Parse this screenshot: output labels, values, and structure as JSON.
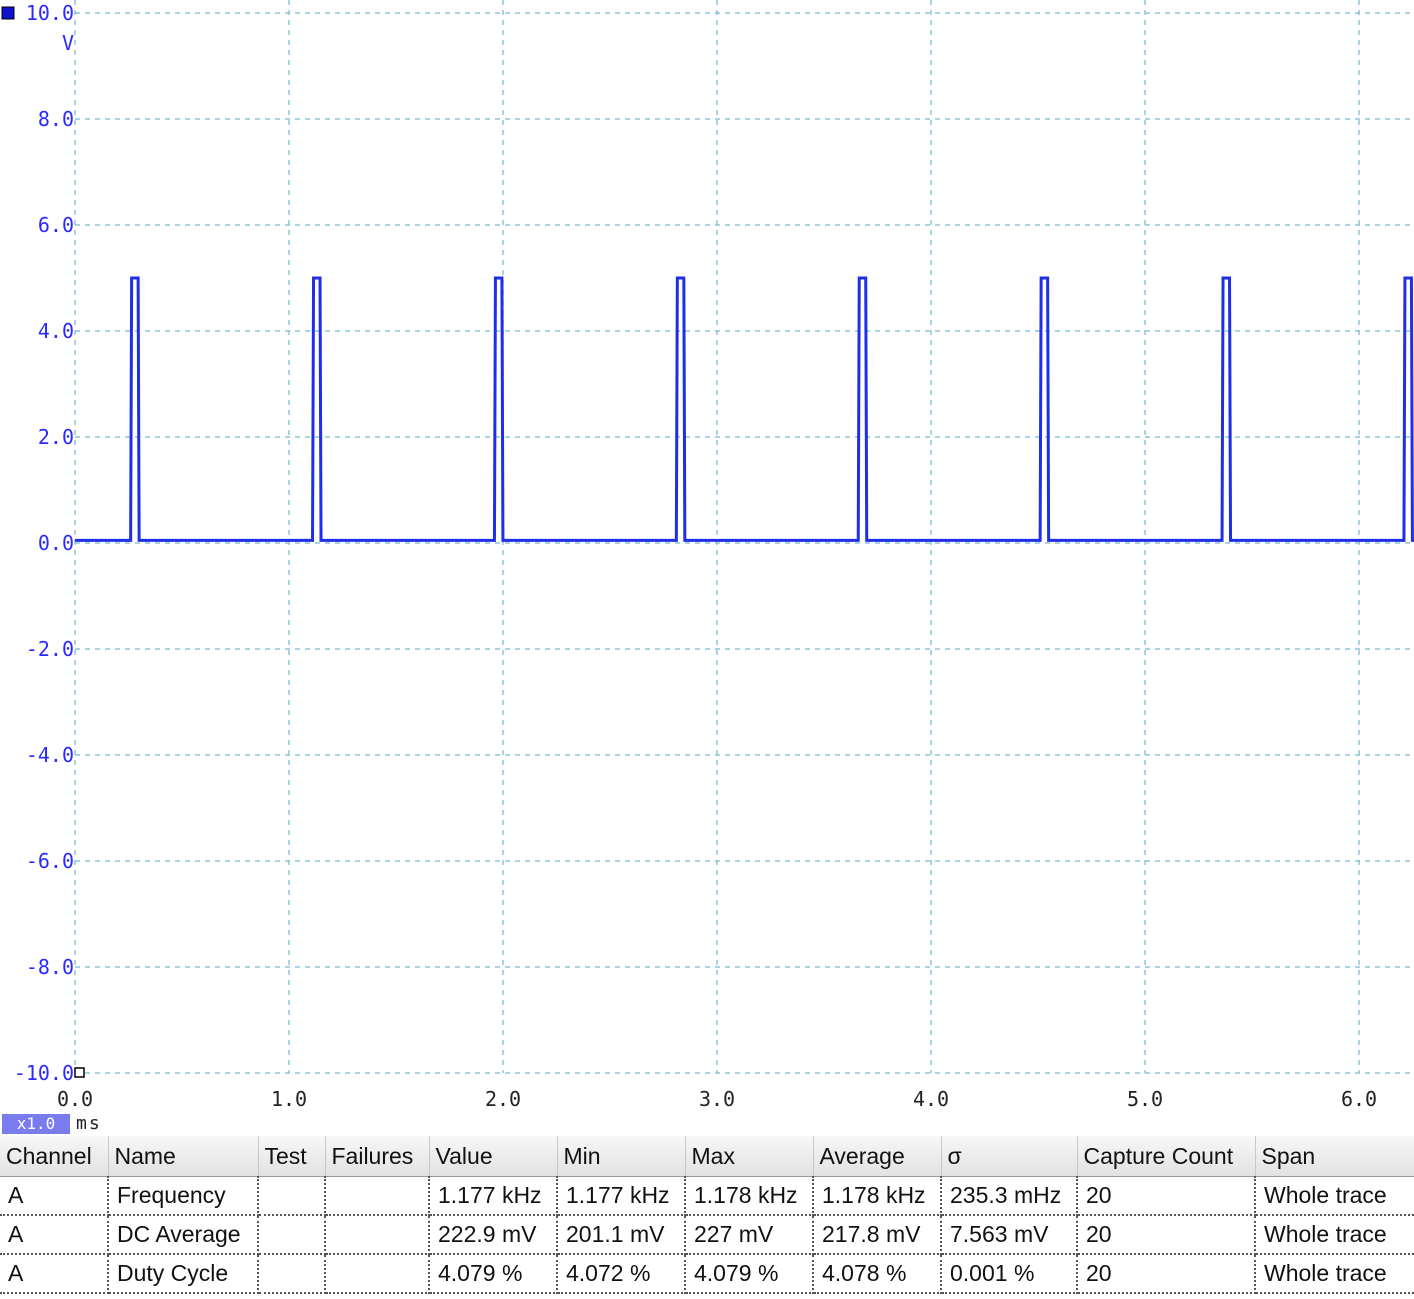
{
  "chart_data": {
    "type": "line",
    "y_unit": "V",
    "x_unit": "ms",
    "ylim": [
      -10.0,
      10.0
    ],
    "xlim": [
      0.0,
      6.26
    ],
    "y_ticks": [
      "10.0",
      "8.0",
      "6.0",
      "4.0",
      "2.0",
      "0.0",
      "-2.0",
      "-4.0",
      "-6.0",
      "-8.0",
      "-10.0"
    ],
    "x_ticks": [
      "0.0",
      "1.0",
      "2.0",
      "3.0",
      "4.0",
      "5.0",
      "6.0"
    ],
    "grid": true,
    "series": [
      {
        "channel": "A",
        "color": "#1f2ee8",
        "low_level_v": 0.05,
        "high_level_v": 5.0,
        "pulse_width_ms": 0.035,
        "pulse_rise_times_ms": [
          0.26,
          1.11,
          1.96,
          2.81,
          3.66,
          4.51,
          5.36,
          6.21
        ]
      }
    ]
  },
  "zoom": {
    "label": "x1.0"
  },
  "measurements": {
    "columns": [
      "Channel",
      "Name",
      "Test",
      "Failures",
      "Value",
      "Min",
      "Max",
      "Average",
      "σ",
      "Capture Count",
      "Span"
    ],
    "rows": [
      [
        "A",
        "Frequency",
        "",
        "",
        "1.177 kHz",
        "1.177 kHz",
        "1.178 kHz",
        "1.178 kHz",
        "235.3 mHz",
        "20",
        "Whole trace"
      ],
      [
        "A",
        "DC Average",
        "",
        "",
        "222.9 mV",
        "201.1 mV",
        "227 mV",
        "217.8 mV",
        "7.563 mV",
        "20",
        "Whole trace"
      ],
      [
        "A",
        "Duty Cycle",
        "",
        "",
        "4.079 %",
        "4.072 %",
        "4.079 %",
        "4.078 %",
        "0.001 %",
        "20",
        "Whole trace"
      ]
    ]
  }
}
